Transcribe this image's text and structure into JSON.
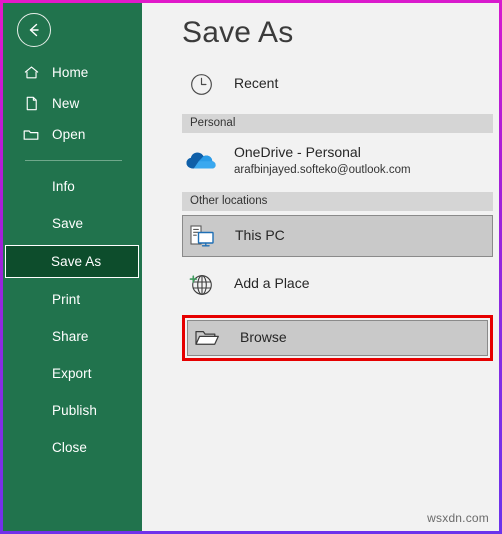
{
  "window": {
    "frame_gradient_from": "#e619c8",
    "frame_gradient_to": "#6a33ec",
    "watermark": "wsxdn.com"
  },
  "sidebar": {
    "background_color": "#21734d",
    "back_button": {
      "name": "back-arrow-icon",
      "label": "Back"
    },
    "items": [
      {
        "label": "Home",
        "icon": "home-icon",
        "indented": false,
        "active": false
      },
      {
        "label": "New",
        "icon": "new-icon",
        "indented": false,
        "active": false
      },
      {
        "label": "Open",
        "icon": "folder-icon",
        "indented": false,
        "active": false
      },
      {
        "label": "Info",
        "icon": "",
        "indented": true,
        "active": false
      },
      {
        "label": "Save",
        "icon": "",
        "indented": true,
        "active": false
      },
      {
        "label": "Save As",
        "icon": "",
        "indented": true,
        "active": true
      },
      {
        "label": "Print",
        "icon": "",
        "indented": true,
        "active": false
      },
      {
        "label": "Share",
        "icon": "",
        "indented": true,
        "active": false
      },
      {
        "label": "Export",
        "icon": "",
        "indented": true,
        "active": false
      },
      {
        "label": "Publish",
        "icon": "",
        "indented": true,
        "active": false
      },
      {
        "label": "Close",
        "icon": "",
        "indented": true,
        "active": false
      }
    ]
  },
  "main": {
    "title": "Save As",
    "recent": {
      "label": "Recent",
      "icon": "clock-icon"
    },
    "personal_header": "Personal",
    "onedrive": {
      "name": "OneDrive - Personal",
      "account": "arafbinjayed.softeko@outlook.com",
      "icon": "onedrive-cloud-icon"
    },
    "other_locations_header": "Other locations",
    "this_pc": {
      "label": "This PC",
      "icon": "this-pc-icon",
      "selected": true
    },
    "add_a_place": {
      "label": "Add a Place",
      "icon": "globe-plus-icon"
    },
    "browse": {
      "label": "Browse",
      "icon": "open-folder-icon",
      "highlight_color": "#e60000"
    }
  }
}
